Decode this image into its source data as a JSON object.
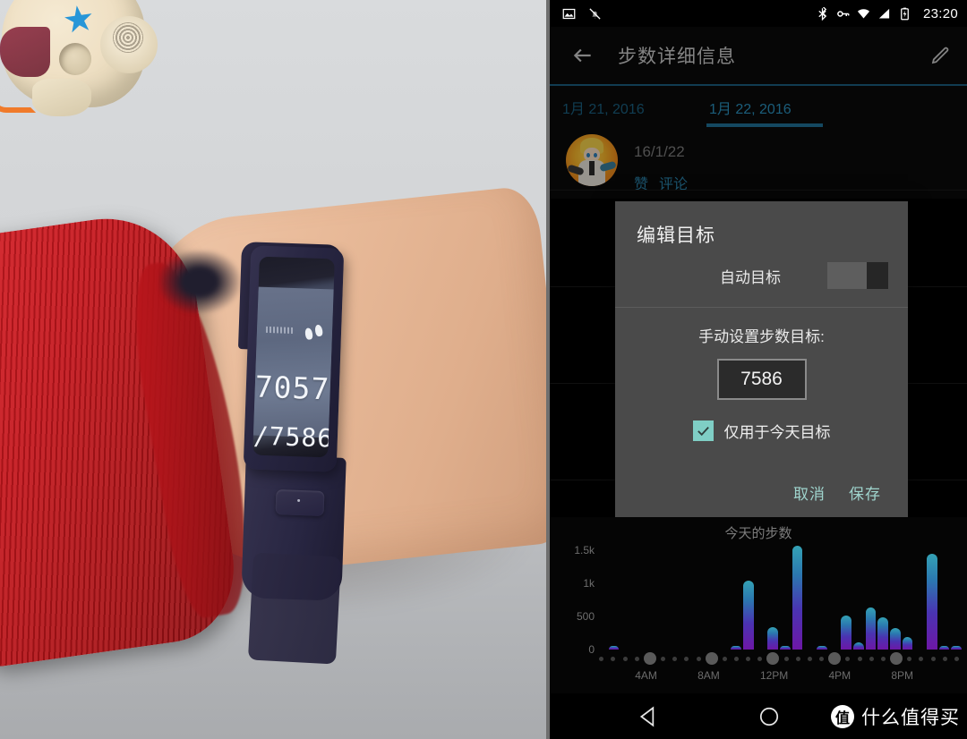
{
  "status_bar": {
    "time": "23:20",
    "icons": [
      "image-icon",
      "bell-muted-icon",
      "bluetooth-icon",
      "vpn-key-icon",
      "wifi-icon",
      "signal-icon",
      "battery-charging-icon"
    ]
  },
  "app_bar": {
    "back_icon": "back-arrow-icon",
    "title": "步数详细信息",
    "edit_icon": "edit-pencil-icon"
  },
  "tabs": [
    {
      "label": "1月 21, 2016",
      "active": false
    },
    {
      "label": "1月 22, 2016",
      "active": true
    }
  ],
  "post": {
    "avatar": "user-avatar",
    "date": "16/1/22",
    "actions": [
      "赞",
      "评论"
    ]
  },
  "dialog": {
    "title": "编辑目标",
    "auto_goal_label": "自动目标",
    "auto_goal_enabled": false,
    "manual_label": "手动设置步数目标:",
    "goal_value": "7586",
    "checkbox_label": "仅用于今天目标",
    "checkbox_checked": true,
    "cancel_label": "取消",
    "save_label": "保存",
    "accent_color": "#9fd4cd",
    "checkbox_color": "#7fcec5"
  },
  "chart_data": {
    "type": "bar",
    "title": "今天的步数",
    "xlabel": "",
    "ylabel": "",
    "ylim": [
      0,
      1600
    ],
    "ytick_labels": [
      "0",
      "500",
      "1k",
      "1.5k"
    ],
    "ytick_values": [
      0,
      500,
      1000,
      1500
    ],
    "grid": false,
    "legend": null,
    "xtick_labels": [
      "4AM",
      "8AM",
      "12PM",
      "4PM",
      "8PM"
    ],
    "bar_gradient": [
      "#34a2b5",
      "#6d17a6"
    ],
    "categories": [
      "0",
      "1",
      "2",
      "3",
      "4",
      "5",
      "6",
      "7",
      "8",
      "9",
      "10",
      "11",
      "12",
      "13",
      "14",
      "15",
      "16",
      "17",
      "18",
      "19",
      "20",
      "21",
      "22",
      "23",
      "24",
      "25",
      "26",
      "27"
    ],
    "values": [
      0,
      60,
      0,
      0,
      0,
      0,
      0,
      0,
      0,
      0,
      0,
      45,
      1050,
      0,
      340,
      55,
      1570,
      0,
      25,
      0,
      520,
      110,
      640,
      495,
      330,
      185,
      0,
      1450
    ],
    "trailing_values": [
      35,
      40
    ]
  },
  "band_photo": {
    "steps": "7057",
    "goal": "/7586",
    "icon": "footprints-icon",
    "progress_percent": 93
  },
  "nav_bar": {
    "back_icon": "nav-back-triangle-icon",
    "home_icon": "nav-home-circle-icon",
    "watermark_logo": "值",
    "watermark_text": "什么值得买"
  }
}
